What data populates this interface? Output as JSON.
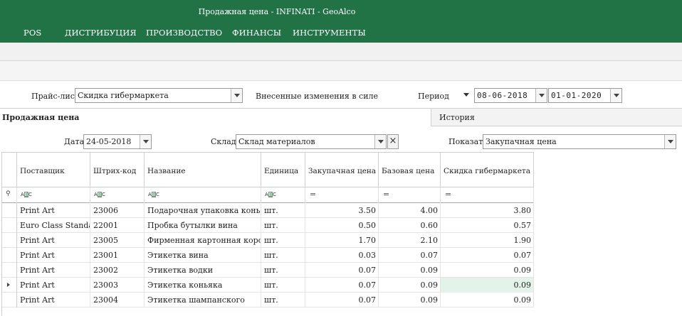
{
  "window": {
    "title": "Продажная цена - INFINATI - GeoAlco"
  },
  "menu": [
    "POS",
    "ДИСТРИБУЦИЯ",
    "ПРОИЗВОДСТВО",
    "ФИНАНСЫ",
    "ИНСТРУМЕНТЫ"
  ],
  "pricelist": {
    "label": "Прайс-лист",
    "value": "Скидка гибермаркета",
    "changes_label": "Внесенные изменения в силе",
    "period_label": "Период",
    "period_from": "08-06-2018",
    "period_to": "01-01-2020"
  },
  "tabs": {
    "active": "Продажная цена",
    "inactive": "История"
  },
  "filters": {
    "date_label": "Дата",
    "date_value": "24-05-2018",
    "warehouse_label": "Склад",
    "warehouse_value": "Склад материалов",
    "show_label": "Показать",
    "show_value": "Закупачная цена"
  },
  "grid": {
    "columns": [
      "Поставщик",
      "Штрих-код",
      "Название",
      "Единица",
      "Закупачная цена",
      "Базовая цена",
      "Скидка гибермаркета"
    ],
    "filter_text_icon": "abc-filter-icon",
    "filter_num_icon": "equals-filter-icon",
    "rows": [
      {
        "supplier": "Print Art",
        "barcode": "23006",
        "name": "Подарочная упаковка коньяка",
        "unit": "шт.",
        "purchase": "3.50",
        "base": "4.00",
        "discount": "3.80"
      },
      {
        "supplier": "Euro Class Standart",
        "barcode": "22001",
        "name": "Пробка бутылки вина",
        "unit": "шт.",
        "purchase": "0.50",
        "base": "0.60",
        "discount": "0.57"
      },
      {
        "supplier": "Print Art",
        "barcode": "23005",
        "name": "Фирменная картонная коробка",
        "unit": "шт.",
        "purchase": "1.70",
        "base": "2.10",
        "discount": "1.90"
      },
      {
        "supplier": "Print Art",
        "barcode": "23001",
        "name": "Этикетка вина",
        "unit": "шт.",
        "purchase": "0.03",
        "base": "0.07",
        "discount": "0.07"
      },
      {
        "supplier": "Print Art",
        "barcode": "23002",
        "name": "Этикетка водки",
        "unit": "шт.",
        "purchase": "0.07",
        "base": "0.09",
        "discount": "0.09"
      },
      {
        "supplier": "Print Art",
        "barcode": "23003",
        "name": "Этикетка коньяка",
        "unit": "шт.",
        "purchase": "0.07",
        "base": "0.09",
        "discount": "0.09"
      },
      {
        "supplier": "Print Art",
        "barcode": "23004",
        "name": "Этикетка шампанского",
        "unit": "шт.",
        "purchase": "0.07",
        "base": "0.09",
        "discount": "0.09"
      }
    ],
    "current_row_index": 5,
    "highlight_color": "#e4f3ea"
  },
  "colors": {
    "brand": "#217346"
  }
}
